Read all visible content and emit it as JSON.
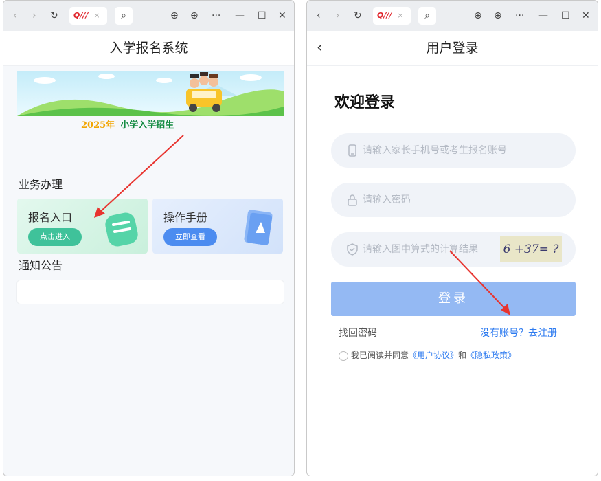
{
  "browser": {
    "tab_logo": "Q///",
    "tab_dot": ".",
    "tab_close": "×",
    "back_glyph": "‹",
    "forward_glyph": "›",
    "reload_glyph": "↻",
    "search_glyph": "⌕",
    "download_glyph": "⊕",
    "globe_glyph": "⊕",
    "more_glyph": "···",
    "minimize_glyph": "—",
    "maximize_glyph": "☐",
    "close_glyph": "✕"
  },
  "left": {
    "title": "入学报名系统",
    "banner_year": "2025年",
    "banner_title": "小学入学招生",
    "section_business": "业务办理",
    "card1": {
      "title": "报名入口",
      "button": "点击进入"
    },
    "card2": {
      "title": "操作手册",
      "button": "立即查看"
    },
    "section_notice": "通知公告"
  },
  "right": {
    "title": "用户登录",
    "back": "‹",
    "welcome": "欢迎登录",
    "phone_placeholder": "请输入家长手机号或考生报名账号",
    "password_placeholder": "请输入密码",
    "captcha_placeholder": "请输入图中算式的计算结果",
    "captcha_text": "6 +37= ?",
    "login_button": "登录",
    "forgot": "找回密码",
    "register": "没有账号？去注册",
    "agree_prefix": "我已阅读并同意",
    "user_agreement": "《用户协议》",
    "agree_and": "和",
    "privacy_policy": "《隐私政策》"
  },
  "colors": {
    "accent_blue": "#2e7bf0",
    "login_btn": "#94b9f3",
    "green_card": "#d7f5e6",
    "blue_card": "#dbe8fb",
    "arrow_red": "#e8342f"
  }
}
